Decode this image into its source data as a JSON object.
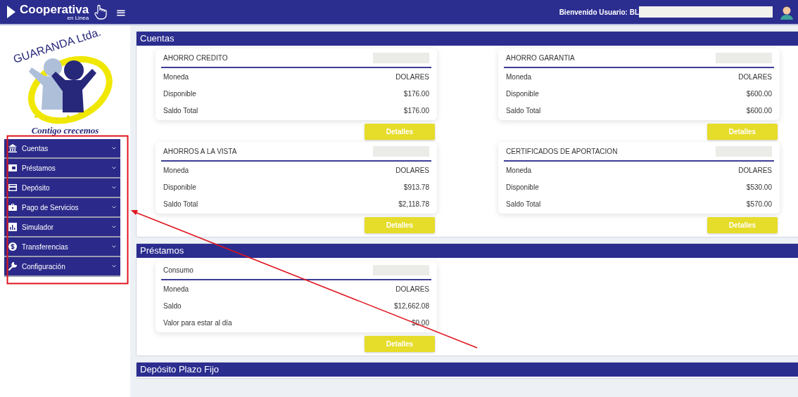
{
  "header": {
    "brand": "Cooperativa",
    "brand_sub": "en Linea",
    "menu_glyph": "≡",
    "welcome": "Bienvenido Usuario: BL"
  },
  "sidebar": {
    "logo_title": "GUARANDA Ltda.",
    "logo_slogan": "Contigo crecemos",
    "items": [
      {
        "label": "Cuentas"
      },
      {
        "label": "Préstamos"
      },
      {
        "label": "Depósito"
      },
      {
        "label": "Pago de Servicios"
      },
      {
        "label": "Simulador"
      },
      {
        "label": "Transferencias"
      },
      {
        "label": "Configuración"
      }
    ]
  },
  "sections": [
    {
      "title": "Cuentas",
      "cards": [
        {
          "title": "AHORRO CREDITO",
          "rows": [
            {
              "label": "Moneda",
              "value": "DOLARES"
            },
            {
              "label": "Disponible",
              "value": "$176.00"
            },
            {
              "label": "Saldo Total",
              "value": "$176.00"
            }
          ],
          "button": "Detalles"
        },
        {
          "title": "AHORRO GARANTIA",
          "rows": [
            {
              "label": "Moneda",
              "value": "DOLARES"
            },
            {
              "label": "Disponible",
              "value": "$600.00"
            },
            {
              "label": "Saldo Total",
              "value": "$600.00"
            }
          ],
          "button": "Detalles"
        },
        {
          "title": "AHORROS A LA VISTA",
          "rows": [
            {
              "label": "Moneda",
              "value": "DOLARES"
            },
            {
              "label": "Disponible",
              "value": "$913.78"
            },
            {
              "label": "Saldo Total",
              "value": "$2,118.78"
            }
          ],
          "button": "Detalles"
        },
        {
          "title": "CERTIFICADOS DE APORTACION",
          "rows": [
            {
              "label": "Moneda",
              "value": "DOLARES"
            },
            {
              "label": "Disponible",
              "value": "$530.00"
            },
            {
              "label": "Saldo Total",
              "value": "$570.00"
            }
          ],
          "button": "Detalles"
        }
      ]
    },
    {
      "title": "Préstamos",
      "cards": [
        {
          "title": "Consumo",
          "rows": [
            {
              "label": "Moneda",
              "value": "DOLARES"
            },
            {
              "label": "Saldo",
              "value": "$12,662.08"
            },
            {
              "label": "Valor para estar al día",
              "value": "$0.00"
            }
          ],
          "button": "Detalles"
        }
      ]
    },
    {
      "title": "Depósito Plazo Fijo"
    }
  ]
}
